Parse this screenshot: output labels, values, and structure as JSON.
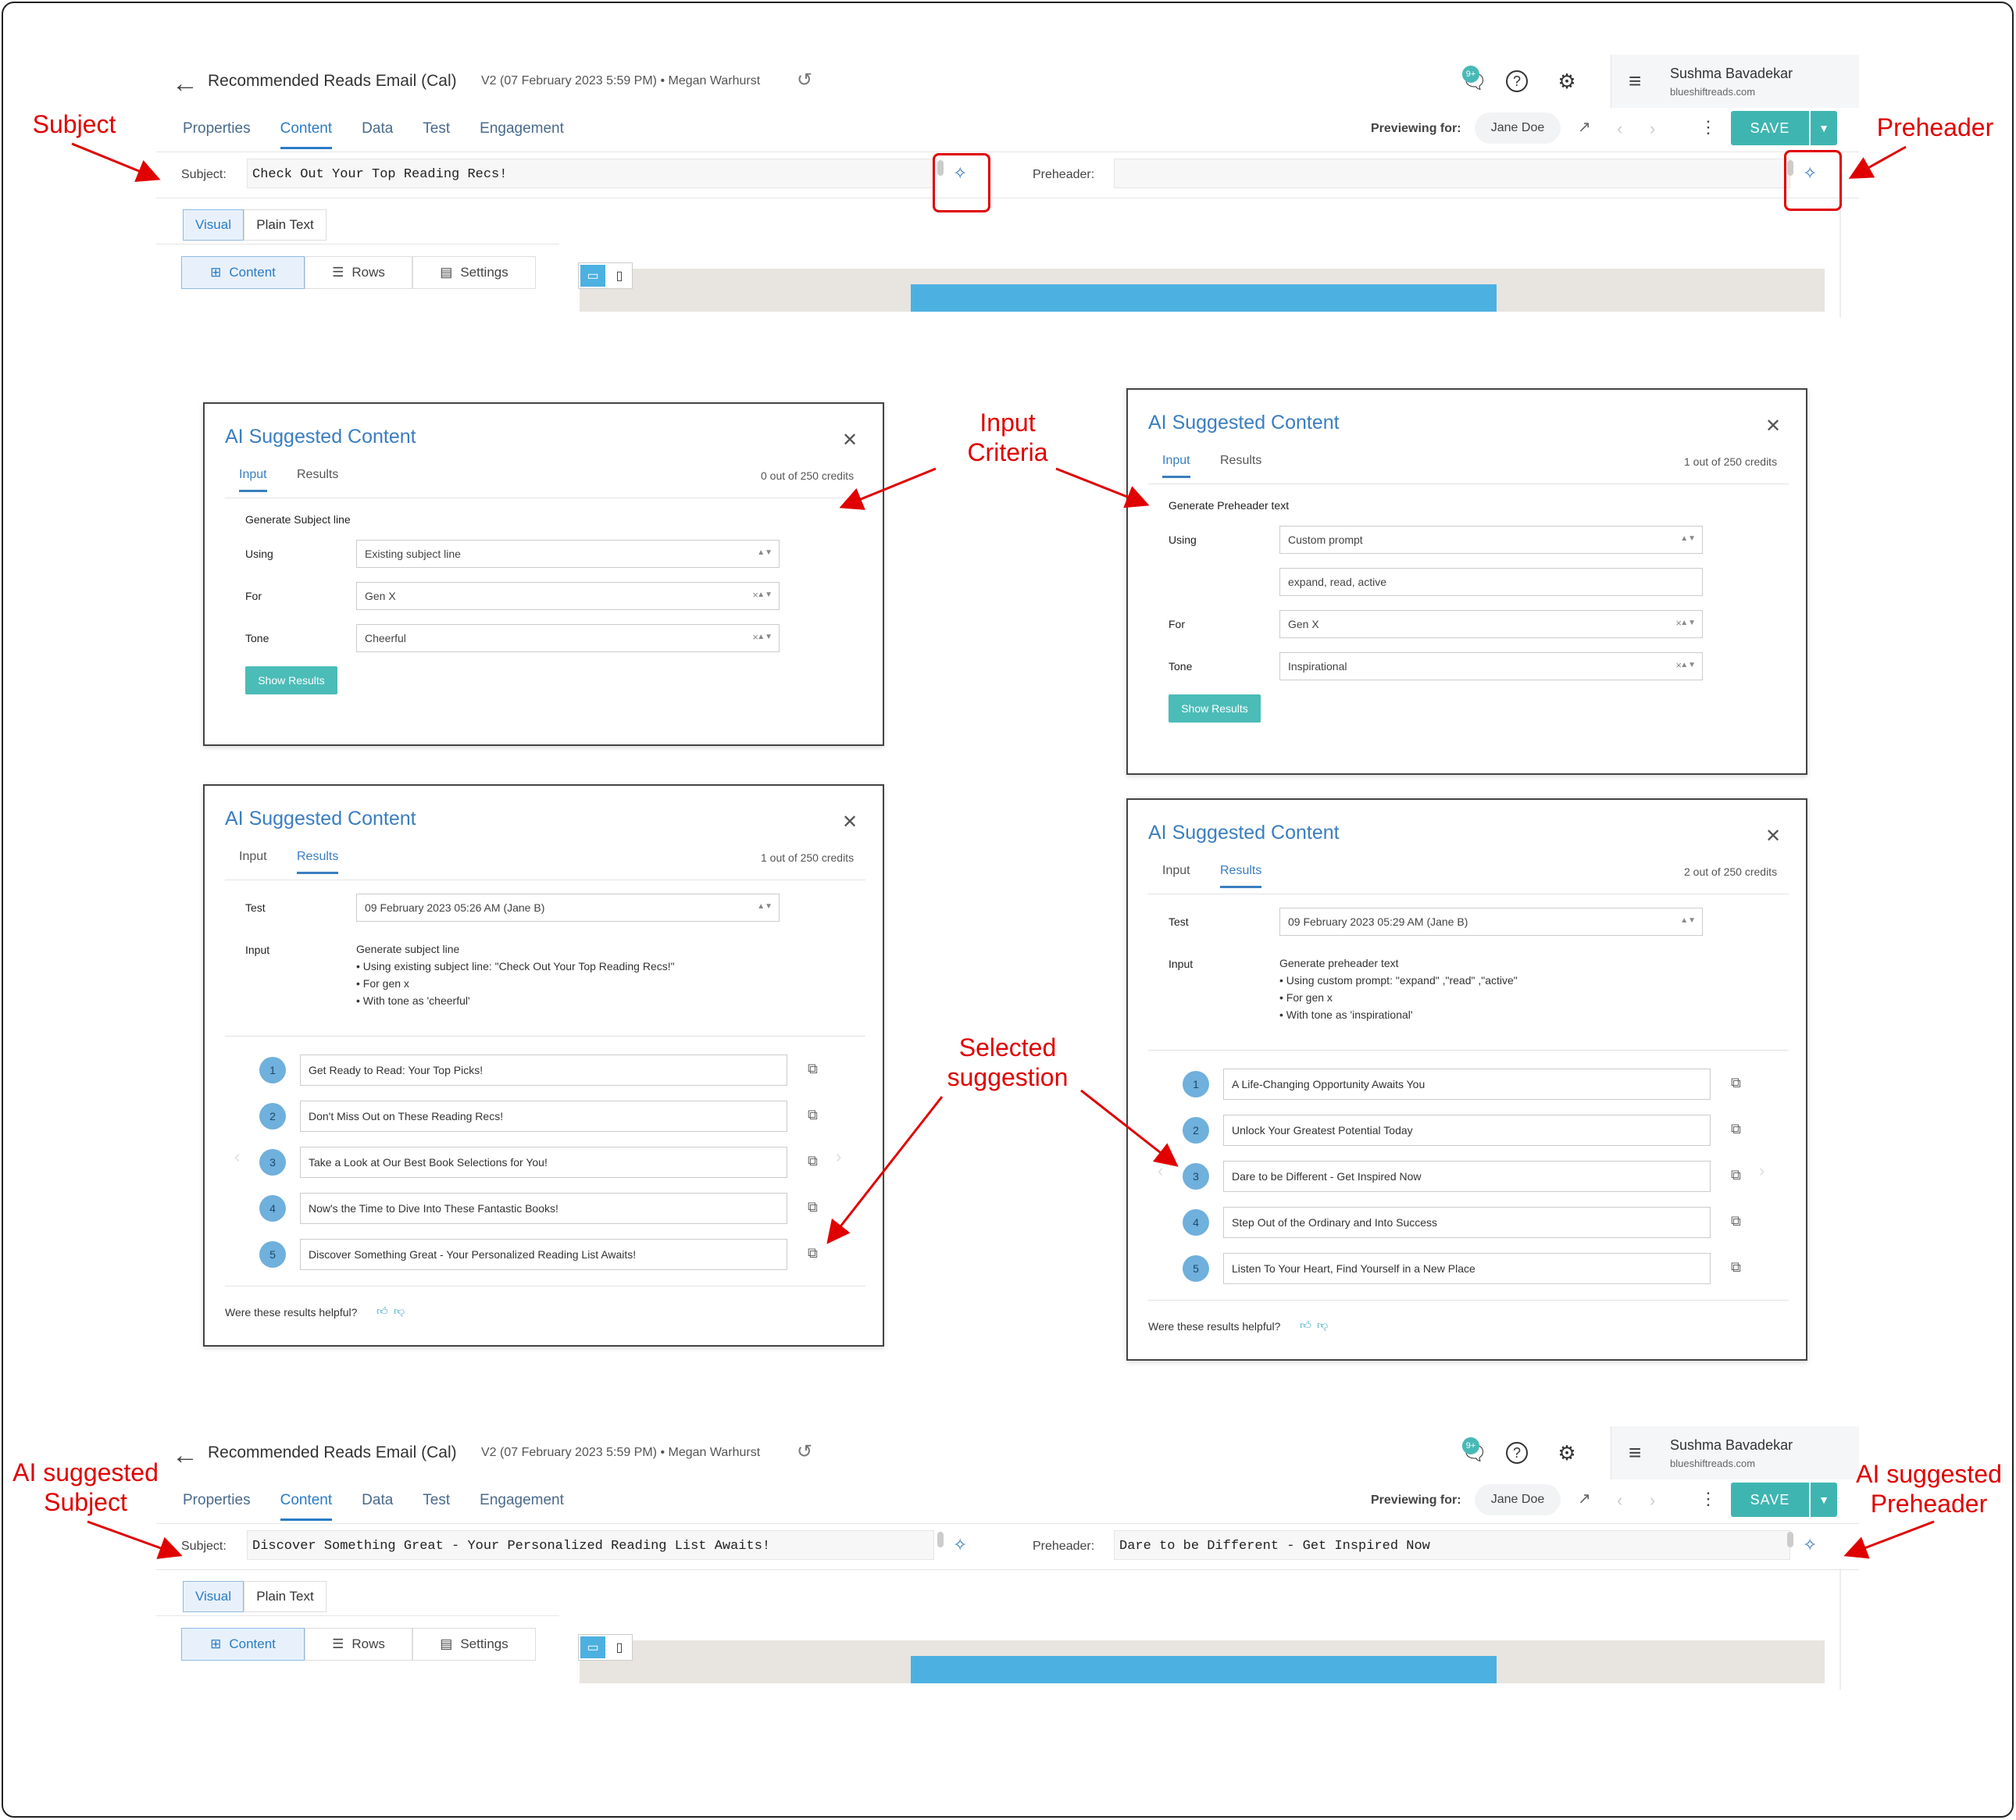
{
  "app": {
    "back_icon": "back-arrow-icon",
    "email_title": "Recommended Reads Email (Cal)",
    "version_info": "V2 (07 February 2023 5:59 PM)",
    "bullet": "•",
    "author": "Megan Warhurst",
    "notifications_badge": "9+",
    "user_name": "Sushma Bavadekar",
    "user_domain": "blueshiftreads.com",
    "tabs": [
      "Properties",
      "Content",
      "Data",
      "Test",
      "Engagement"
    ],
    "active_tab": "Content",
    "previewing_label": "Previewing for:",
    "previewing_user": "Jane Doe",
    "save_label": "SAVE",
    "subject_label": "Subject:",
    "preheader_label": "Preheader:",
    "visual_label": "Visual",
    "plain_text_label": "Plain Text",
    "content_label": "Content",
    "rows_label": "Rows",
    "settings_label": "Settings"
  },
  "top_screen": {
    "subject_value": "Check Out Your Top Reading Recs!",
    "preheader_value": ""
  },
  "bottom_screen": {
    "subject_value": "Discover Something Great - Your Personalized Reading List Awaits!",
    "preheader_value": "Dare to be Different - Get Inspired Now"
  },
  "dialogs": {
    "title": "AI Suggested Content",
    "input_tab": "Input",
    "results_tab": "Results",
    "helpful_q": "Were these results helpful?",
    "subject_input": {
      "credits": "0 out of 250 credits",
      "heading": "Generate Subject line",
      "using_label": "Using",
      "using_value": "Existing subject line",
      "for_label": "For",
      "for_value": "Gen X",
      "tone_label": "Tone",
      "tone_value": "Cheerful",
      "button": "Show Results"
    },
    "preheader_input": {
      "credits": "1 out of 250 credits",
      "heading": "Generate Preheader text",
      "using_label": "Using",
      "using_value": "Custom prompt",
      "prompt_value": "expand, read, active",
      "for_label": "For",
      "for_value": "Gen X",
      "tone_label": "Tone",
      "tone_value": "Inspirational",
      "button": "Show Results"
    },
    "subject_results": {
      "credits": "1 out of 250 credits",
      "test_label": "Test",
      "test_value": "09 February 2023 05:26 AM (Jane B)",
      "input_label": "Input",
      "input_heading": "Generate subject line",
      "input_lines": [
        "Using existing subject line: \"Check Out Your Top Reading Recs!\"",
        "For gen x",
        "With tone as 'cheerful'"
      ],
      "suggestions": [
        "Get Ready to Read: Your Top Picks!",
        "Don't Miss Out on These Reading Recs!",
        "Take a Look at Our Best Book Selections for You!",
        "Now's the Time to Dive Into These Fantastic Books!",
        "Discover Something Great - Your Personalized Reading List Awaits!"
      ]
    },
    "preheader_results": {
      "credits": "2 out of 250 credits",
      "test_label": "Test",
      "test_value": "09 February 2023 05:29 AM (Jane B)",
      "input_label": "Input",
      "input_heading": "Generate preheader text",
      "input_lines": [
        "Using custom prompt: \"expand\" ,\"read\" ,\"active\"",
        "For gen x",
        "With tone as 'inspirational'"
      ],
      "suggestions": [
        "A Life-Changing Opportunity Awaits You",
        "Unlock Your Greatest Potential Today",
        "Dare to be Different - Get Inspired Now",
        "Step Out of the Ordinary and Into Success",
        "Listen To Your Heart, Find Yourself in a New Place"
      ]
    }
  },
  "annotations": {
    "subject": "Subject",
    "preheader": "Preheader",
    "input_criteria_1": "Input",
    "input_criteria_2": "Criteria",
    "selected_1": "Selected",
    "selected_2": "suggestion",
    "ai_subject_1": "AI suggested",
    "ai_subject_2": "Subject",
    "ai_preheader_1": "AI suggested",
    "ai_preheader_2": "Preheader",
    "color": "#e00000"
  },
  "colors": {
    "accent": "#3a7ec0",
    "save": "#3fb5b1",
    "annotation": "#e00000"
  }
}
